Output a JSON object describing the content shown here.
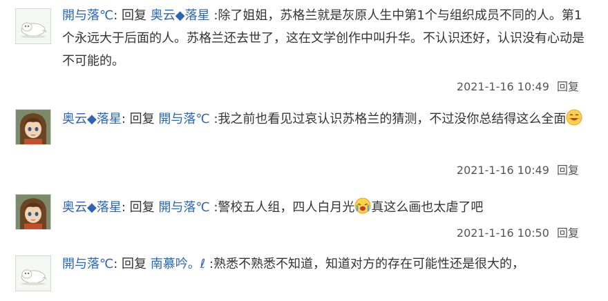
{
  "replies": [
    {
      "author": "開与落℃",
      "sep": ": ",
      "reply_word": "回复 ",
      "target": "奥云◆落星",
      "text": " :除了姐姐，苏格兰就是灰原人生中第1个与组织成员不同的人。第1个永远大于后面的人。苏格兰还去世了，这在文学创作中叫升华。不认识还好，认识没有心动是不可能的。",
      "time": "2021-1-16 10:49",
      "action": "回复",
      "avatar_icon": "white-seal-icon"
    },
    {
      "author": "奥云◆落星",
      "sep": ": ",
      "reply_word": "回复 ",
      "target": "開与落℃",
      "text": " :我之前也看见过哀认识苏格兰的猜测，不过没你总结得这么全面",
      "time": "2021-1-16 10:49",
      "action": "回复",
      "avatar_icon": "anime-girl-icon",
      "emoji_icon": "smile-emoji-icon"
    },
    {
      "author": "奥云◆落星",
      "sep": ": ",
      "reply_word": "回复 ",
      "target": "開与落℃",
      "text_before": " :警校五人组，四人白月光",
      "text_after": "真这么画也太虐了吧",
      "time": "2021-1-16 10:50",
      "action": "回复",
      "avatar_icon": "anime-girl-icon",
      "emoji_icon": "crying-emoji-icon"
    },
    {
      "author": "開与落℃",
      "sep": ": ",
      "reply_word": "回复 ",
      "target": "南慕吟。ℓ",
      "text": " :熟悉不熟悉不知道，知道对方的存在可能性还是很大的，",
      "avatar_icon": "white-seal-icon"
    }
  ],
  "colors": {
    "link": "#2d64b3",
    "text": "#333333",
    "meta": "#555555"
  }
}
